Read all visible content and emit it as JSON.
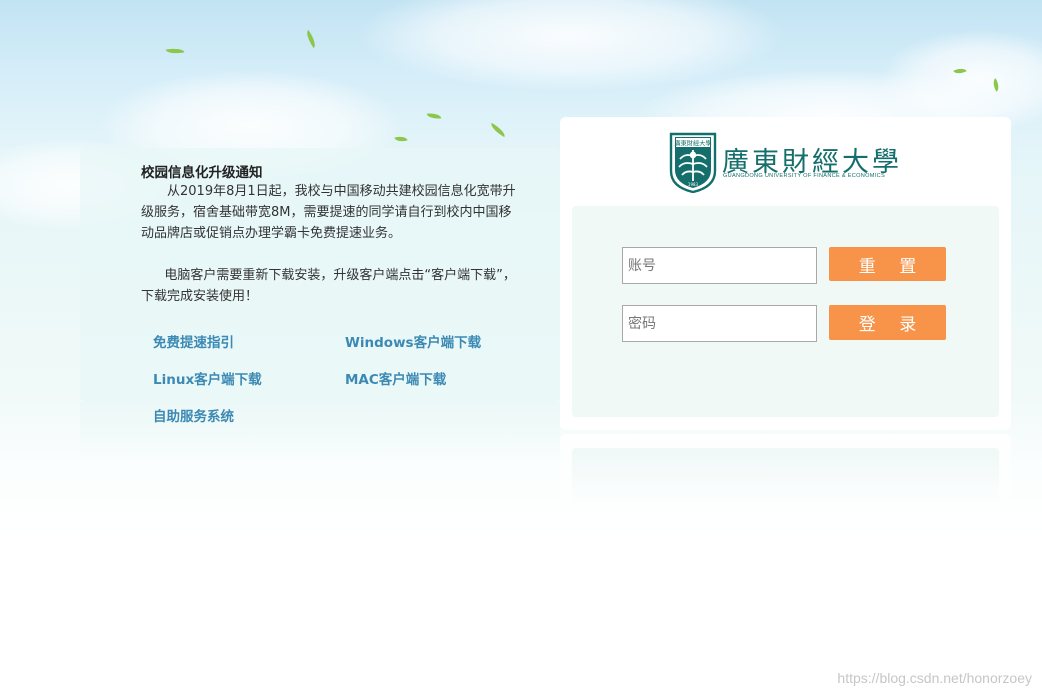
{
  "notice": {
    "title": "校园信息化升级通知",
    "paragraph1": "从2019年8月1日起，我校与中国移动共建校园信息化宽带升级服务，宿舍基础带宽8M，需要提速的同学请自行到校内中国移动品牌店或促销点办理学霸卡免费提速业务。",
    "paragraph2": "电脑客户需要重新下载安装，升级客户端点击“客户端下载”，下载完成安装使用！"
  },
  "links": {
    "speedup_guide": "免费提速指引",
    "windows_download": "Windows客户端下载",
    "linux_download": "Linux客户端下载",
    "mac_download": "MAC客户端下载",
    "self_service": "自助服务系统"
  },
  "logo": {
    "name_cn": "廣東財經大學",
    "name_en": "GUANGDONG UNIVERSITY OF FINANCE & ECONOMICS",
    "emblem_text": "廣東財經大學",
    "emblem_year": "1983",
    "brand_color": "#146f6c"
  },
  "login": {
    "account_placeholder": "账号",
    "account_value": "",
    "password_placeholder": "密码",
    "password_value": "",
    "reset_label": "重 置",
    "login_label": "登 录",
    "button_color": "#f7944a"
  },
  "watermark": "https://blog.csdn.net/honorzoey"
}
